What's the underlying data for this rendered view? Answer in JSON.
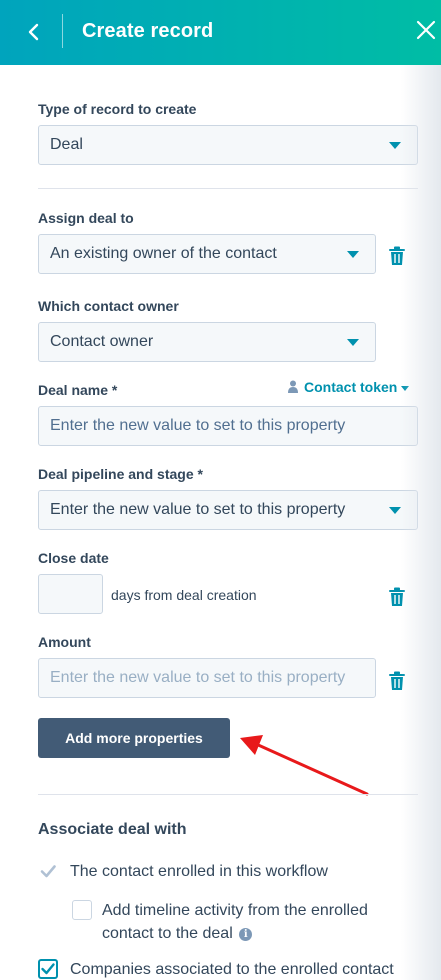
{
  "header": {
    "title": "Create record"
  },
  "record_type": {
    "label": "Type of record to create",
    "value": "Deal"
  },
  "assign": {
    "label": "Assign deal to",
    "value": "An existing owner of the contact"
  },
  "owner": {
    "label": "Which contact owner",
    "value": "Contact owner"
  },
  "deal_name": {
    "label": "Deal name *",
    "placeholder": "Enter the new value to set to this property",
    "token_label": "Contact token"
  },
  "pipeline": {
    "label": "Deal pipeline and stage *",
    "value": "Enter the new value to set to this property"
  },
  "close_date": {
    "label": "Close date",
    "suffix": "days from deal creation",
    "value": ""
  },
  "amount": {
    "label": "Amount",
    "placeholder": "Enter the new value to set to this property"
  },
  "add_button": "Add more properties",
  "associate": {
    "title": "Associate deal with",
    "items": [
      {
        "label": "The contact enrolled in this workflow",
        "checked": true,
        "disabled": true
      },
      {
        "label": "Add timeline activity from the enrolled contact to the deal",
        "checked": false,
        "info": "i"
      },
      {
        "label": "Companies associated to the enrolled contact",
        "checked": true
      }
    ]
  },
  "colors": {
    "header_start": "#00a4bd",
    "header_end": "#00bda5",
    "accent": "#0091ae",
    "button": "#425b76",
    "annotation_arrow": "#e8191b"
  }
}
